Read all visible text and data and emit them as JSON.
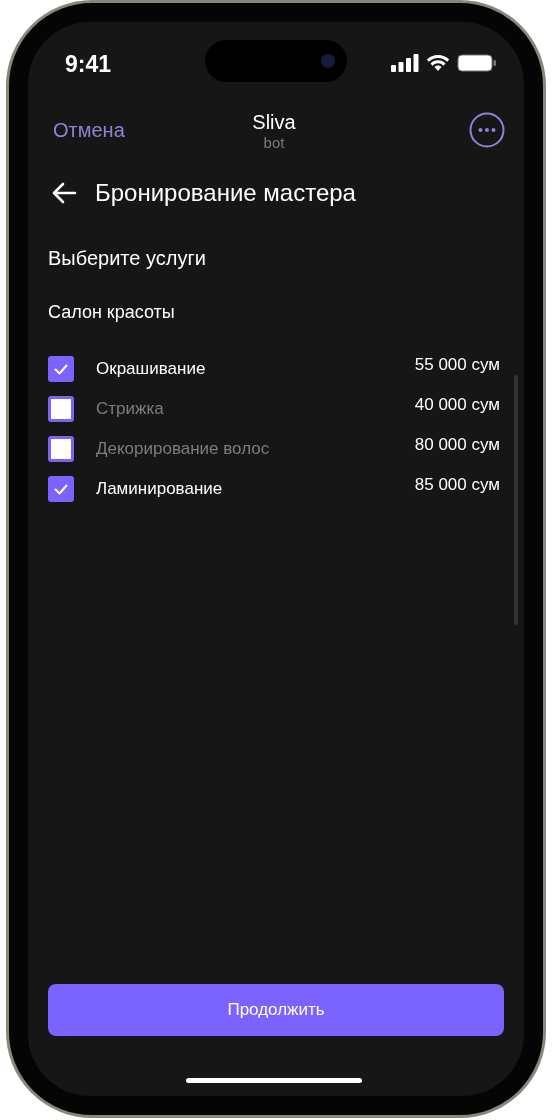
{
  "status_bar": {
    "time": "9:41"
  },
  "header": {
    "cancel": "Отмена",
    "title": "Sliva",
    "subtitle": "bot"
  },
  "page_title": "Бронирование мастера",
  "section_title": "Выберите услуги",
  "category": "Салон красоты",
  "services": [
    {
      "name": "Окрашивание",
      "price": "55 000 сум",
      "checked": true
    },
    {
      "name": "Стрижка",
      "price": "40 000 сум",
      "checked": false
    },
    {
      "name": "Декорирование волос",
      "price": "80 000 сум",
      "checked": false
    },
    {
      "name": "Ламинирование",
      "price": "85 000 сум",
      "checked": true
    }
  ],
  "continue_button": "Продолжить"
}
